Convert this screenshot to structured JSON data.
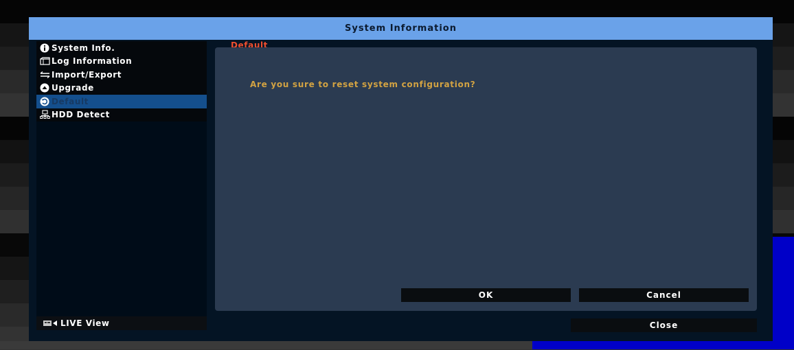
{
  "dialog": {
    "title": "System Information"
  },
  "sidebar": {
    "items": [
      {
        "label": "System Info.",
        "icon": "info-icon"
      },
      {
        "label": "Log Information",
        "icon": "log-icon"
      },
      {
        "label": "Import/Export",
        "icon": "import-export-icon"
      },
      {
        "label": "Upgrade",
        "icon": "upgrade-icon"
      },
      {
        "label": "Default",
        "icon": "reset-icon",
        "active": true
      },
      {
        "label": "HDD Detect",
        "icon": "hdd-icon"
      }
    ],
    "live_view_label": "LIVE View"
  },
  "main": {
    "tab_label": "Default",
    "message": "Are you sure to reset system configuration?",
    "ok_label": "OK",
    "cancel_label": "Cancel"
  },
  "footer": {
    "close_label": "Close"
  },
  "colors": {
    "title_bar": "#6aa2e9",
    "active_item": "#144f8d",
    "tab_label": "#f04f2f",
    "message": "#d3a342",
    "panel": "#2b3b51"
  }
}
